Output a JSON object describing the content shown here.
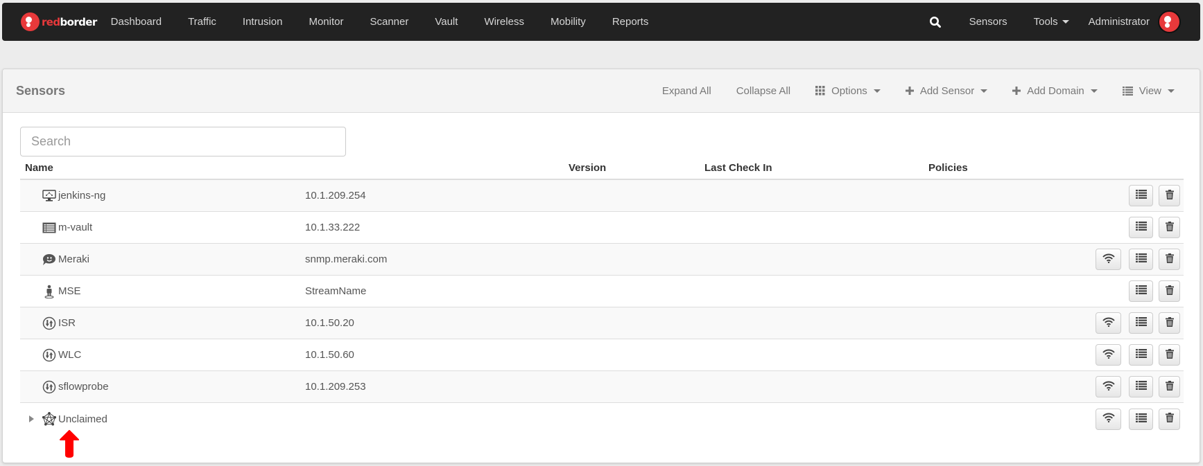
{
  "navbar": {
    "brand": {
      "prefix": "red",
      "suffix": "border"
    },
    "items": [
      "Dashboard",
      "Traffic",
      "Intrusion",
      "Monitor",
      "Scanner",
      "Vault",
      "Wireless",
      "Mobility",
      "Reports"
    ],
    "search_icon": "search-icon",
    "sensors_label": "Sensors",
    "tools_label": "Tools",
    "user_label": "Administrator",
    "accent_color": "#e8393b"
  },
  "panel": {
    "title": "Sensors",
    "toolbar": {
      "expand_all": "Expand All",
      "collapse_all": "Collapse All",
      "options": "Options",
      "add_sensor": "Add Sensor",
      "add_domain": "Add Domain",
      "view": "View"
    },
    "search": {
      "placeholder": "Search",
      "value": ""
    },
    "columns": {
      "name": "Name",
      "version": "Version",
      "last_check_in": "Last Check In",
      "policies": "Policies"
    },
    "rows": [
      {
        "name": "jenkins-ng",
        "address": "10.1.209.254",
        "icon": "monitor-network-icon",
        "wifi": false
      },
      {
        "name": "m-vault",
        "address": "10.1.33.222",
        "icon": "list-box-icon",
        "wifi": false
      },
      {
        "name": "Meraki",
        "address": "snmp.meraki.com",
        "icon": "chat-bubble-icon",
        "wifi": true
      },
      {
        "name": "MSE",
        "address": "StreamName",
        "icon": "person-stand-icon",
        "wifi": false
      },
      {
        "name": "ISR",
        "address": "10.1.50.20",
        "icon": "flow-arrows-icon",
        "wifi": true
      },
      {
        "name": "WLC",
        "address": "10.1.50.60",
        "icon": "flow-arrows-icon",
        "wifi": true
      },
      {
        "name": "sflowprobe",
        "address": "10.1.209.253",
        "icon": "flow-arrows-icon",
        "wifi": true
      },
      {
        "name": "Unclaimed",
        "address": "",
        "icon": "network-pentagon-icon",
        "wifi": true,
        "expandable": true
      }
    ]
  }
}
